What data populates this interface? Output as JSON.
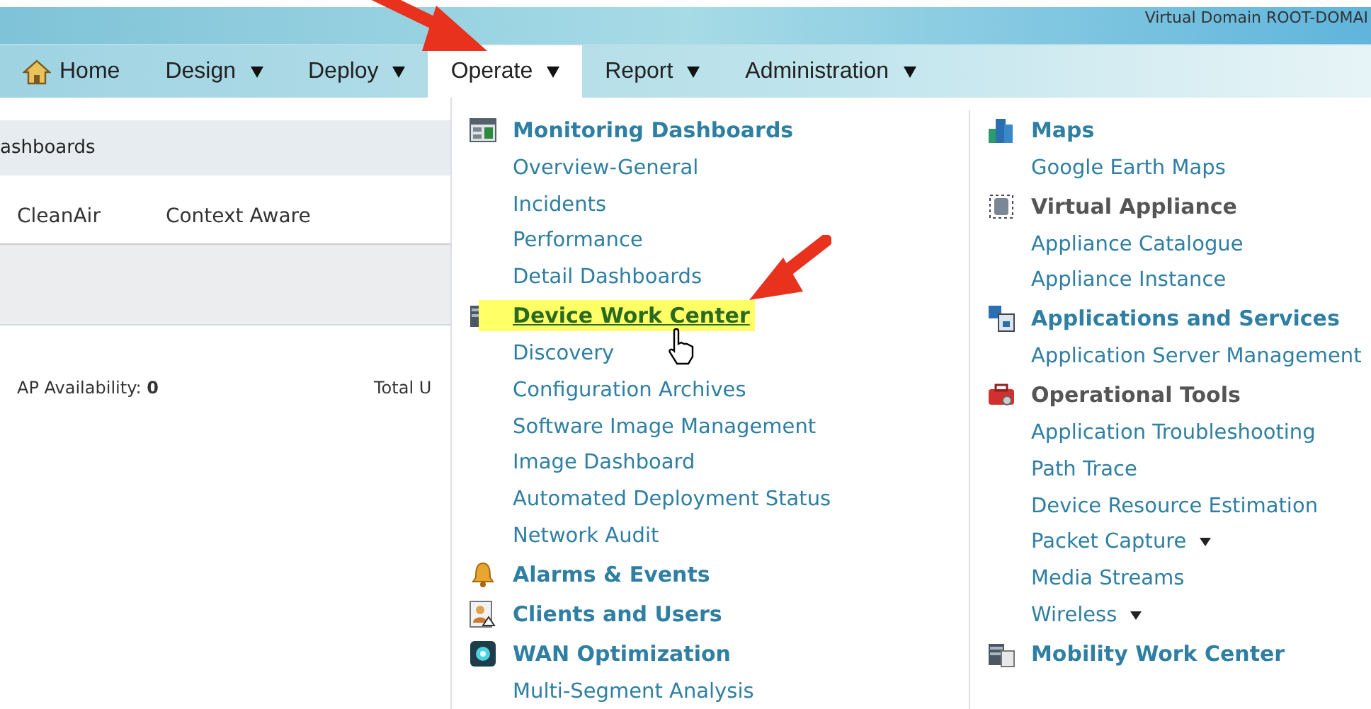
{
  "header": {
    "virtual_domain": "Virtual Domain ROOT-DOMAI"
  },
  "nav": [
    {
      "label": "Home",
      "kind": "home",
      "selected": false
    },
    {
      "label": "Design",
      "kind": "menu",
      "selected": false
    },
    {
      "label": "Deploy",
      "kind": "menu",
      "selected": false
    },
    {
      "label": "Operate",
      "kind": "menu",
      "selected": true
    },
    {
      "label": "Report",
      "kind": "menu",
      "selected": false
    },
    {
      "label": "Administration",
      "kind": "menu",
      "selected": false
    }
  ],
  "page": {
    "section_title": "ashboards",
    "tabs": [
      "CleanAir",
      "Context Aware"
    ],
    "stats": [
      {
        "label": "AP Availability: ",
        "value": "0"
      },
      {
        "label": "Total U"
      }
    ]
  },
  "menu": {
    "columns": [
      [
        {
          "label": "Monitoring Dashboards",
          "kind": "heading",
          "selected": false
        },
        {
          "label": "Overview-General",
          "kind": "link",
          "selected": false
        },
        {
          "label": "Incidents",
          "kind": "link",
          "selected": false
        },
        {
          "label": "Performance",
          "kind": "link",
          "selected": false
        },
        {
          "label": "Detail Dashboards",
          "kind": "link",
          "selected": false
        },
        {
          "label": "Device Work Center",
          "kind": "heading",
          "selected": true
        },
        {
          "label": "Discovery",
          "kind": "link",
          "selected": false
        },
        {
          "label": "Configuration Archives",
          "kind": "link",
          "selected": false
        },
        {
          "label": "Software Image Management",
          "kind": "link",
          "selected": false
        },
        {
          "label": "Image Dashboard",
          "kind": "link",
          "selected": false
        },
        {
          "label": "Automated Deployment Status",
          "kind": "link",
          "selected": false
        },
        {
          "label": "Network Audit",
          "kind": "link",
          "selected": false
        },
        {
          "label": "Alarms & Events",
          "kind": "heading",
          "selected": false
        },
        {
          "label": "Clients and Users",
          "kind": "heading",
          "selected": false
        },
        {
          "label": "WAN Optimization",
          "kind": "heading",
          "selected": false
        },
        {
          "label": "Multi-Segment Analysis",
          "kind": "link",
          "selected": false
        }
      ],
      [
        {
          "label": "Maps",
          "kind": "heading",
          "selected": false
        },
        {
          "label": "Google Earth Maps",
          "kind": "link",
          "selected": false
        },
        {
          "label": "Virtual Appliance",
          "kind": "group",
          "selected": false
        },
        {
          "label": "Appliance Catalogue",
          "kind": "link",
          "selected": false
        },
        {
          "label": "Appliance Instance",
          "kind": "link",
          "selected": false
        },
        {
          "label": "Applications and Services",
          "kind": "heading",
          "selected": false
        },
        {
          "label": "Application Server Management",
          "kind": "link",
          "selected": false
        },
        {
          "label": "Operational Tools",
          "kind": "group",
          "selected": false
        },
        {
          "label": "Application Troubleshooting",
          "kind": "link",
          "selected": false
        },
        {
          "label": "Path Trace",
          "kind": "link",
          "selected": false
        },
        {
          "label": "Device Resource Estimation",
          "kind": "link",
          "selected": false
        },
        {
          "label": "Packet Capture",
          "kind": "submenu",
          "selected": false
        },
        {
          "label": "Media Streams",
          "kind": "link",
          "selected": false
        },
        {
          "label": "Wireless",
          "kind": "submenu",
          "selected": false
        },
        {
          "label": "Mobility Work Center",
          "kind": "heading",
          "selected": false
        }
      ]
    ]
  }
}
